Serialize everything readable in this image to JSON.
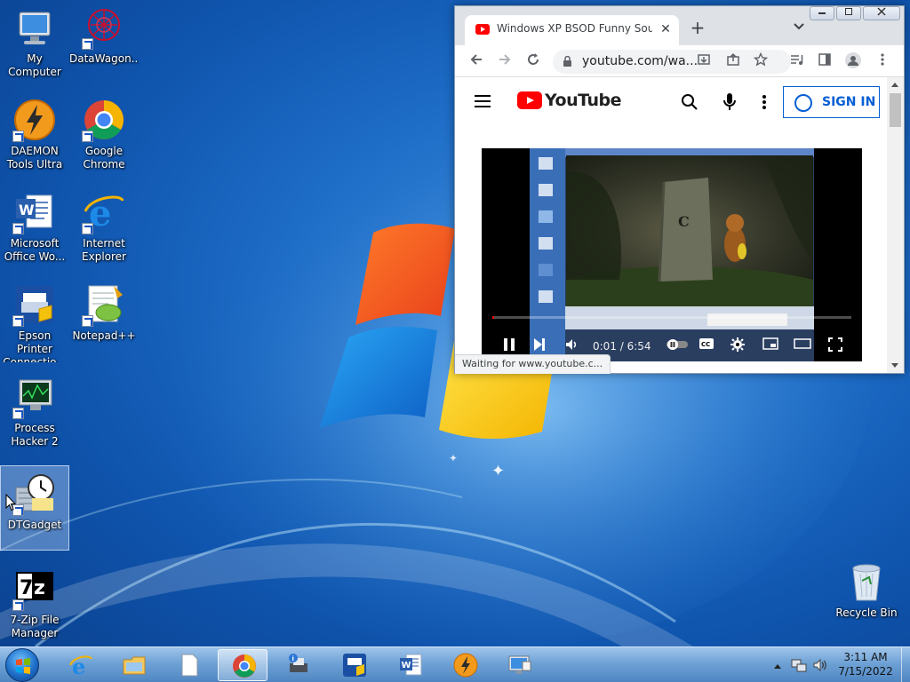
{
  "desktop": {
    "icons": [
      {
        "label": "My Computer",
        "icon": "computer-icon"
      },
      {
        "label": "DataWagon...",
        "icon": "datawagon-icon"
      },
      {
        "label": "DAEMON Tools Ultra",
        "icon": "daemon-tools-icon"
      },
      {
        "label": "Google Chrome",
        "icon": "chrome-icon"
      },
      {
        "label": "Microsoft Office Wo...",
        "icon": "word-icon"
      },
      {
        "label": "Internet Explorer",
        "icon": "internet-explorer-icon"
      },
      {
        "label": "Epson Printer Connectio...",
        "icon": "epson-printer-icon"
      },
      {
        "label": "Notepad++",
        "icon": "notepadpp-icon"
      },
      {
        "label": "Process Hacker 2",
        "icon": "process-hacker-icon"
      },
      {
        "label": "DTGadget",
        "icon": "dtgadget-icon"
      },
      {
        "label": "7-Zip File Manager",
        "icon": "7zip-icon"
      },
      {
        "label": "Recycle Bin",
        "icon": "recycle-bin-icon"
      }
    ]
  },
  "browser": {
    "tab_title": "Windows XP BSOD Funny Sound",
    "tab_close": "✕",
    "new_tab": "+",
    "url": "youtube.com/wa...",
    "status_text": "Waiting for www.youtube.c...",
    "youtube": {
      "brand": "YouTube",
      "sign_in": "SIGN IN",
      "timecode": "0:01 / 6:54",
      "progress_fraction": 0.0025
    }
  },
  "taskbar": {
    "apps": [
      "internet-explorer-icon",
      "file-explorer-icon",
      "blank-document-icon",
      "chrome-icon",
      "printer-info-icon",
      "epson-printer-icon",
      "word-icon",
      "daemon-tools-icon",
      "remote-desktop-icon"
    ],
    "active_app": "chrome-icon",
    "clock_time": "3:11 AM",
    "clock_date": "7/15/2022"
  }
}
